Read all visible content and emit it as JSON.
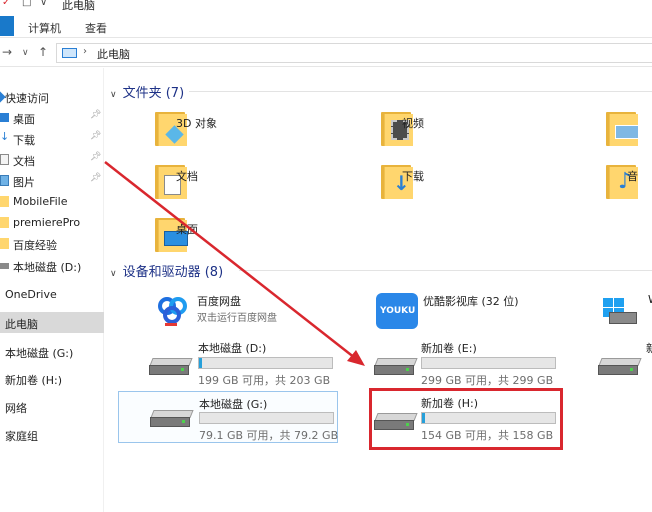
{
  "window": {
    "title": "此电脑"
  },
  "ribbon": {
    "tabs": [
      "计算机",
      "查看"
    ]
  },
  "address": {
    "path": "此电脑"
  },
  "sidebar": {
    "items": [
      {
        "label": "快速访问",
        "icon": "star-icon",
        "pinned": false
      },
      {
        "label": "桌面",
        "icon": "desktop-icon",
        "pinned": true
      },
      {
        "label": "下载",
        "icon": "download-icon",
        "pinned": true
      },
      {
        "label": "文档",
        "icon": "document-icon",
        "pinned": true
      },
      {
        "label": "图片",
        "icon": "picture-icon",
        "pinned": true
      },
      {
        "label": "MobileFile",
        "icon": "folder-icon",
        "pinned": false
      },
      {
        "label": "premierePro",
        "icon": "folder-icon",
        "pinned": false
      },
      {
        "label": "百度经验",
        "icon": "folder-icon",
        "pinned": false
      },
      {
        "label": "本地磁盘 (D:)",
        "icon": "drive-icon",
        "pinned": false
      },
      {
        "label": "OneDrive",
        "icon": "cloud-icon",
        "pinned": false
      },
      {
        "label": "此电脑",
        "icon": "computer-icon",
        "pinned": false,
        "selected": true
      },
      {
        "label": "本地磁盘 (G:)",
        "icon": "drive-icon",
        "pinned": false
      },
      {
        "label": "新加卷 (H:)",
        "icon": "drive-icon",
        "pinned": false
      },
      {
        "label": "网络",
        "icon": "network-icon",
        "pinned": false
      },
      {
        "label": "家庭组",
        "icon": "homegroup-icon",
        "pinned": false
      }
    ]
  },
  "folders_group": {
    "title": "文件夹 (7)",
    "items": [
      {
        "name": "3D 对象",
        "icon": "3d-objects-folder-icon"
      },
      {
        "name": "视频",
        "icon": "videos-folder-icon"
      },
      {
        "name": "",
        "icon": "pictures-folder-icon"
      },
      {
        "name": "文档",
        "icon": "documents-folder-icon"
      },
      {
        "name": "下载",
        "icon": "downloads-folder-icon"
      },
      {
        "name": "音",
        "icon": "music-folder-icon"
      },
      {
        "name": "桌面",
        "icon": "desktop-folder-icon"
      }
    ]
  },
  "devices_group": {
    "title": "设备和驱动器 (8)",
    "apps": [
      {
        "name": "百度网盘",
        "subtitle": "双击运行百度网盘",
        "icon": "baidu-netdisk-icon"
      },
      {
        "name": "优酷影视库 (32 位)",
        "icon": "youku-icon",
        "icon_text": "YOUKU"
      },
      {
        "name": "W",
        "icon": "windows-icon"
      }
    ],
    "drives": [
      {
        "name": "本地磁盘 (D:)",
        "size": "199 GB 可用，共 203 GB",
        "used_fraction": 0.02
      },
      {
        "name": "新加卷 (E:)",
        "size": "299 GB 可用，共 299 GB",
        "used_fraction": 0.0
      },
      {
        "name": "新",
        "size": "",
        "used_fraction": 0.0
      },
      {
        "name": "本地磁盘 (G:)",
        "size": "79.1 GB 可用，共 79.2 GB",
        "used_fraction": 0.0
      },
      {
        "name": "新加卷 (H:)",
        "size": "154 GB 可用，共 158 GB",
        "used_fraction": 0.025
      }
    ]
  },
  "colors": {
    "accent": "#26a0da",
    "highlight": "#d9272e",
    "group_title": "#1e3287"
  }
}
